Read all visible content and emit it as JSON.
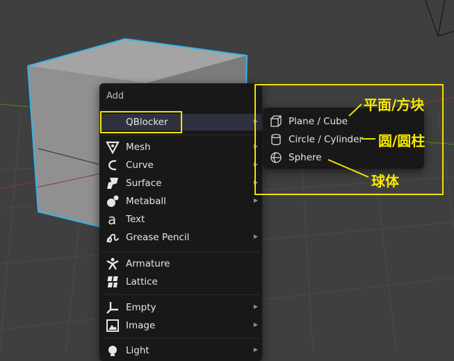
{
  "add_menu": {
    "title": "Add",
    "items": [
      {
        "label": "QBlocker",
        "icon": "none",
        "has_submenu": true
      },
      {
        "label": "Mesh",
        "icon": "mesh-icon",
        "has_submenu": true
      },
      {
        "label": "Curve",
        "icon": "curve-icon",
        "has_submenu": true
      },
      {
        "label": "Surface",
        "icon": "surface-icon",
        "has_submenu": true
      },
      {
        "label": "Metaball",
        "icon": "metaball-icon",
        "has_submenu": true
      },
      {
        "label": "Text",
        "icon": "text-icon",
        "has_submenu": false
      },
      {
        "label": "Grease Pencil",
        "icon": "grease-pencil-icon",
        "has_submenu": true
      },
      {
        "label": "Armature",
        "icon": "armature-icon",
        "has_submenu": false
      },
      {
        "label": "Lattice",
        "icon": "lattice-icon",
        "has_submenu": false
      },
      {
        "label": "Empty",
        "icon": "empty-icon",
        "has_submenu": true
      },
      {
        "label": "Image",
        "icon": "image-icon",
        "has_submenu": true
      },
      {
        "label": "Light",
        "icon": "light-icon",
        "has_submenu": true
      }
    ]
  },
  "qblocker_submenu": {
    "items": [
      {
        "label": "Plane / Cube",
        "icon": "cube-outline-icon"
      },
      {
        "label": "Circle / Cylinder",
        "icon": "cylinder-outline-icon"
      },
      {
        "label": "Sphere",
        "icon": "sphere-outline-icon"
      }
    ]
  },
  "annotations": {
    "plane_cube": "平面/方块",
    "circle_cylinder": "圆/圆柱",
    "sphere": "球体"
  },
  "colors": {
    "annotation": "#f2e300",
    "selection_outline": "#35b5ea",
    "menu_bg": "#181818",
    "highlight_bg": "#2f3140"
  }
}
